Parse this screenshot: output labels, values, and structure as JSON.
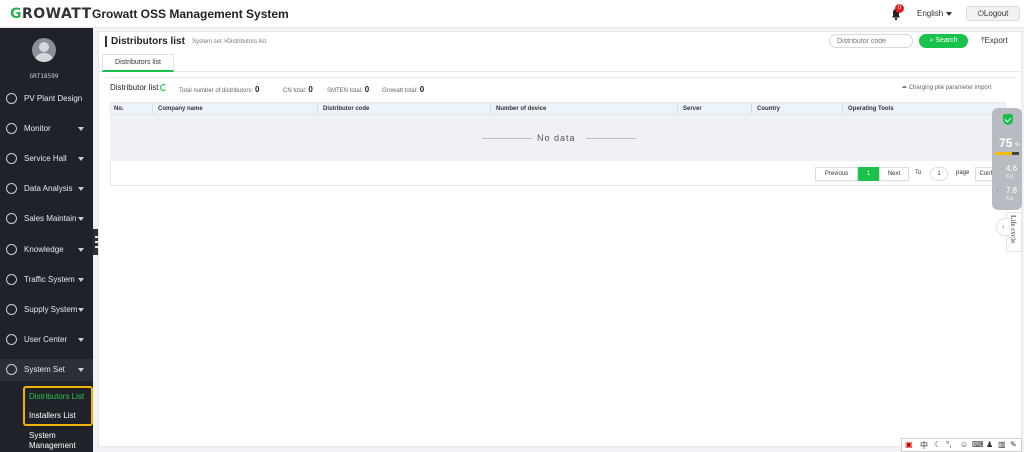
{
  "header": {
    "logo_mark": "G",
    "logo_rest": "ROWATT",
    "system_title": "Growatt OSS Management System",
    "notification_count": "0",
    "language": "English",
    "logout_label": "Logout"
  },
  "user": {
    "id": "GRT18599"
  },
  "sidebar": {
    "items": [
      {
        "label": "PV Plant Design",
        "icon": "pv-design-icon",
        "has_caret": false
      },
      {
        "label": "Monitor",
        "icon": "monitor-icon",
        "has_caret": true
      },
      {
        "label": "Service Hall",
        "icon": "service-hall-icon",
        "has_caret": true
      },
      {
        "label": "Data Analysis",
        "icon": "data-analysis-icon",
        "has_caret": true
      },
      {
        "label": "Sales Maintain",
        "icon": "sales-maintain-icon",
        "has_caret": true
      },
      {
        "label": "Knowledge",
        "icon": "knowledge-icon",
        "has_caret": true
      },
      {
        "label": "Traffic System",
        "icon": "traffic-system-icon",
        "has_caret": true
      },
      {
        "label": "Supply System",
        "icon": "supply-system-icon",
        "has_caret": true
      },
      {
        "label": "User Center",
        "icon": "user-center-icon",
        "has_caret": true
      },
      {
        "label": "System Set",
        "icon": "system-set-icon",
        "has_caret": true,
        "active": true
      }
    ],
    "submenu": [
      {
        "label": "Distributors List",
        "active": true
      },
      {
        "label": "Installers List",
        "active": false
      }
    ],
    "extra_line1": "System",
    "extra_line2": "Management"
  },
  "page": {
    "title": "Distributors list",
    "breadcrumb": "System set >Distributors list",
    "search_placeholder": "Distributor code",
    "search_label": "Search",
    "export_label": "Export",
    "tab_label": "Distributors list"
  },
  "list": {
    "heading": "Distributor list",
    "stats": [
      {
        "label": "Total number of distributors:",
        "value": "0"
      },
      {
        "label": "CN total:",
        "value": "0"
      },
      {
        "label": "SMTEN total:",
        "value": "0"
      },
      {
        "label": "Growatt total:",
        "value": "0"
      }
    ],
    "charging_import": "Charging pile parameter import",
    "columns": [
      "No.",
      "Company name",
      "Distributor code",
      "Number of device",
      "Server",
      "Country",
      "Operating Tools"
    ],
    "no_data": "No data"
  },
  "pagination": {
    "previous": "Previous",
    "current_page": "1",
    "next": "Next",
    "to_label": "To",
    "page_input": "1",
    "page_label": "page",
    "confirm": "Confirm"
  },
  "widget": {
    "score": "75",
    "score_unit": "%",
    "up_value": "4.6",
    "up_unit": "K/s",
    "down_value": "7.8",
    "down_unit": "K/s",
    "lifecycle_label": "Life cycle"
  },
  "colors": {
    "accent": "#19c24a",
    "sidebar_bg": "#1f2329",
    "highlight_box": "#f0b400"
  }
}
